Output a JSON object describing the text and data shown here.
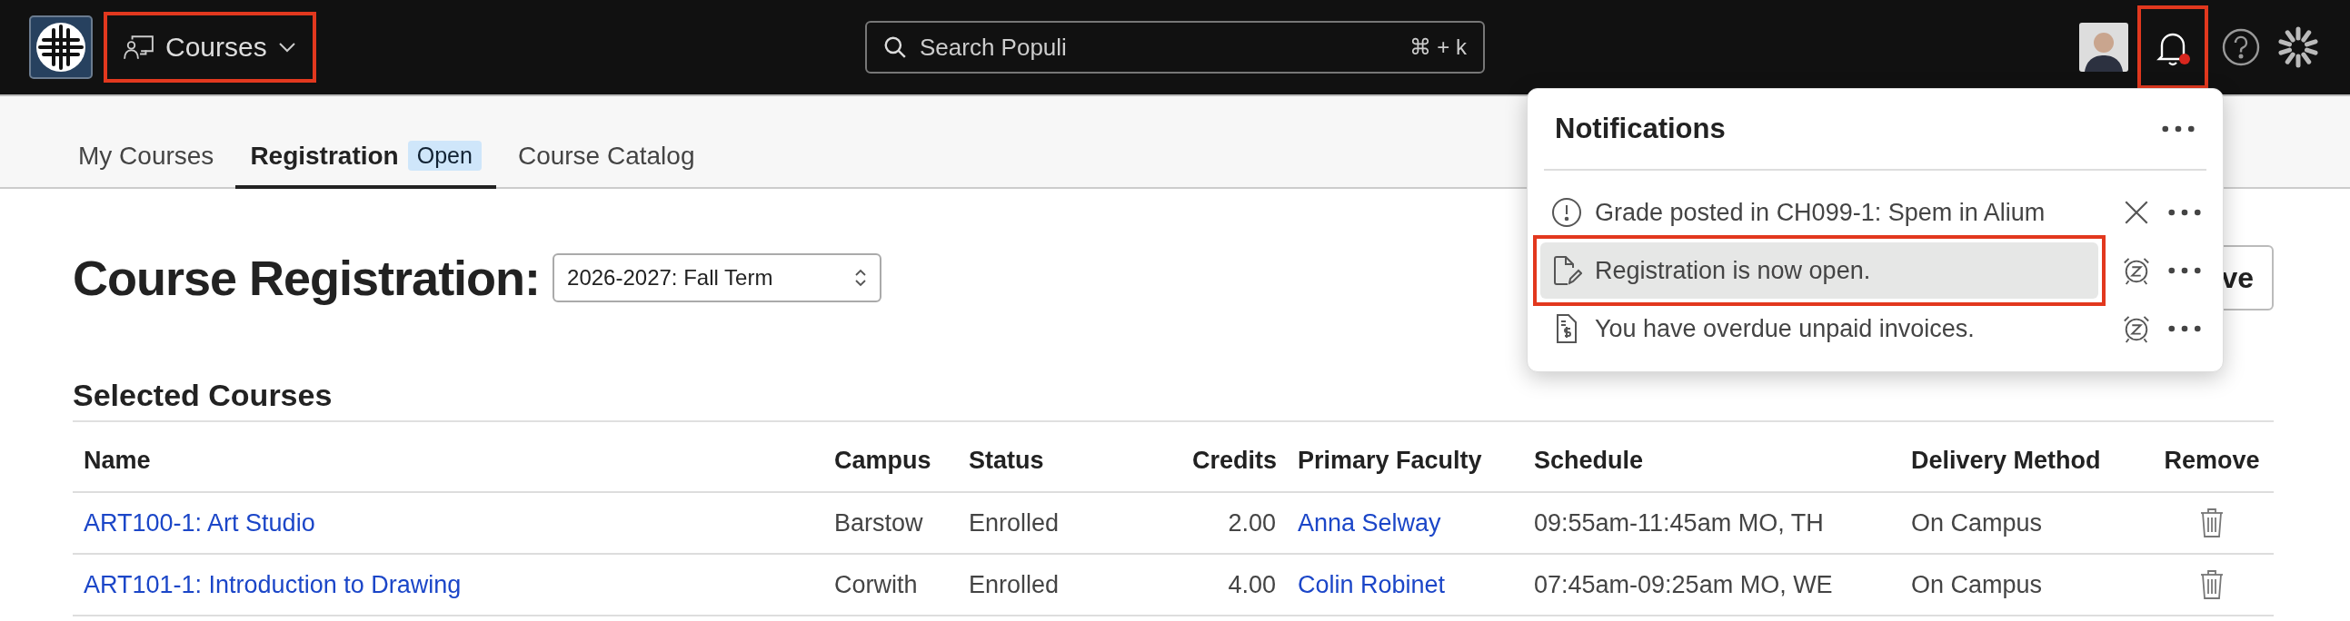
{
  "topbar": {
    "app_menu": {
      "label": "Courses",
      "outlined": true
    },
    "search": {
      "placeholder": "Search Populi",
      "shortcut": "⌘ + k"
    },
    "bell": {
      "unread": true,
      "outlined": true
    }
  },
  "tabs": [
    {
      "label": "My Courses",
      "selected": false
    },
    {
      "label": "Registration",
      "selected": true,
      "badge": "Open"
    },
    {
      "label": "Course Catalog",
      "selected": false
    }
  ],
  "page": {
    "title": "Course Registration:",
    "term_select": {
      "value": "2026-2027: Fall Term"
    },
    "action_button": {
      "label": "ve"
    }
  },
  "selected_courses": {
    "title": "Selected Courses",
    "columns": [
      {
        "label": "Name",
        "kind": "link"
      },
      {
        "label": "Campus",
        "kind": "text"
      },
      {
        "label": "Status",
        "kind": "text"
      },
      {
        "label": "Credits",
        "kind": "number"
      },
      {
        "label": "Primary Faculty",
        "kind": "link"
      },
      {
        "label": "Schedule",
        "kind": "text"
      },
      {
        "label": "Delivery Method",
        "kind": "text"
      },
      {
        "label": "Remove",
        "kind": "remove"
      }
    ],
    "rows": [
      [
        "ART100-1: Art Studio",
        "Barstow",
        "Enrolled",
        "2.00",
        "Anna Selway",
        "09:55am-11:45am MO, TH",
        "On Campus"
      ],
      [
        "ART101-1: Introduction to Drawing",
        "Corwith",
        "Enrolled",
        "4.00",
        "Colin Robinet",
        "07:45am-09:25am MO, WE",
        "On Campus"
      ]
    ]
  },
  "notifications": {
    "title": "Notifications",
    "items": [
      {
        "kind": "alert",
        "text": "Grade posted in CH099-1: Spem in Alium",
        "dismissable": true,
        "selected": false,
        "outlined": false
      },
      {
        "kind": "document",
        "text": "Registration is now open.",
        "dismissable": false,
        "selected": true,
        "outlined": true
      },
      {
        "kind": "invoice",
        "text": "You have overdue unpaid invoices.",
        "dismissable": false,
        "selected": false,
        "outlined": false
      }
    ]
  }
}
